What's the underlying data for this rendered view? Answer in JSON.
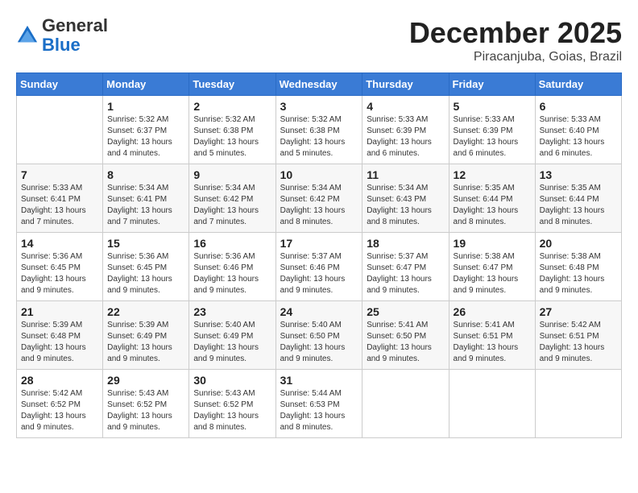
{
  "logo": {
    "general": "General",
    "blue": "Blue"
  },
  "title": "December 2025",
  "subtitle": "Piracanjuba, Goias, Brazil",
  "weekdays": [
    "Sunday",
    "Monday",
    "Tuesday",
    "Wednesday",
    "Thursday",
    "Friday",
    "Saturday"
  ],
  "weeks": [
    [
      {
        "day": "",
        "info": ""
      },
      {
        "day": "1",
        "info": "Sunrise: 5:32 AM\nSunset: 6:37 PM\nDaylight: 13 hours and 4 minutes."
      },
      {
        "day": "2",
        "info": "Sunrise: 5:32 AM\nSunset: 6:38 PM\nDaylight: 13 hours and 5 minutes."
      },
      {
        "day": "3",
        "info": "Sunrise: 5:32 AM\nSunset: 6:38 PM\nDaylight: 13 hours and 5 minutes."
      },
      {
        "day": "4",
        "info": "Sunrise: 5:33 AM\nSunset: 6:39 PM\nDaylight: 13 hours and 6 minutes."
      },
      {
        "day": "5",
        "info": "Sunrise: 5:33 AM\nSunset: 6:39 PM\nDaylight: 13 hours and 6 minutes."
      },
      {
        "day": "6",
        "info": "Sunrise: 5:33 AM\nSunset: 6:40 PM\nDaylight: 13 hours and 6 minutes."
      }
    ],
    [
      {
        "day": "7",
        "info": "Sunrise: 5:33 AM\nSunset: 6:41 PM\nDaylight: 13 hours and 7 minutes."
      },
      {
        "day": "8",
        "info": "Sunrise: 5:34 AM\nSunset: 6:41 PM\nDaylight: 13 hours and 7 minutes."
      },
      {
        "day": "9",
        "info": "Sunrise: 5:34 AM\nSunset: 6:42 PM\nDaylight: 13 hours and 7 minutes."
      },
      {
        "day": "10",
        "info": "Sunrise: 5:34 AM\nSunset: 6:42 PM\nDaylight: 13 hours and 8 minutes."
      },
      {
        "day": "11",
        "info": "Sunrise: 5:34 AM\nSunset: 6:43 PM\nDaylight: 13 hours and 8 minutes."
      },
      {
        "day": "12",
        "info": "Sunrise: 5:35 AM\nSunset: 6:44 PM\nDaylight: 13 hours and 8 minutes."
      },
      {
        "day": "13",
        "info": "Sunrise: 5:35 AM\nSunset: 6:44 PM\nDaylight: 13 hours and 8 minutes."
      }
    ],
    [
      {
        "day": "14",
        "info": "Sunrise: 5:36 AM\nSunset: 6:45 PM\nDaylight: 13 hours and 9 minutes."
      },
      {
        "day": "15",
        "info": "Sunrise: 5:36 AM\nSunset: 6:45 PM\nDaylight: 13 hours and 9 minutes."
      },
      {
        "day": "16",
        "info": "Sunrise: 5:36 AM\nSunset: 6:46 PM\nDaylight: 13 hours and 9 minutes."
      },
      {
        "day": "17",
        "info": "Sunrise: 5:37 AM\nSunset: 6:46 PM\nDaylight: 13 hours and 9 minutes."
      },
      {
        "day": "18",
        "info": "Sunrise: 5:37 AM\nSunset: 6:47 PM\nDaylight: 13 hours and 9 minutes."
      },
      {
        "day": "19",
        "info": "Sunrise: 5:38 AM\nSunset: 6:47 PM\nDaylight: 13 hours and 9 minutes."
      },
      {
        "day": "20",
        "info": "Sunrise: 5:38 AM\nSunset: 6:48 PM\nDaylight: 13 hours and 9 minutes."
      }
    ],
    [
      {
        "day": "21",
        "info": "Sunrise: 5:39 AM\nSunset: 6:48 PM\nDaylight: 13 hours and 9 minutes."
      },
      {
        "day": "22",
        "info": "Sunrise: 5:39 AM\nSunset: 6:49 PM\nDaylight: 13 hours and 9 minutes."
      },
      {
        "day": "23",
        "info": "Sunrise: 5:40 AM\nSunset: 6:49 PM\nDaylight: 13 hours and 9 minutes."
      },
      {
        "day": "24",
        "info": "Sunrise: 5:40 AM\nSunset: 6:50 PM\nDaylight: 13 hours and 9 minutes."
      },
      {
        "day": "25",
        "info": "Sunrise: 5:41 AM\nSunset: 6:50 PM\nDaylight: 13 hours and 9 minutes."
      },
      {
        "day": "26",
        "info": "Sunrise: 5:41 AM\nSunset: 6:51 PM\nDaylight: 13 hours and 9 minutes."
      },
      {
        "day": "27",
        "info": "Sunrise: 5:42 AM\nSunset: 6:51 PM\nDaylight: 13 hours and 9 minutes."
      }
    ],
    [
      {
        "day": "28",
        "info": "Sunrise: 5:42 AM\nSunset: 6:52 PM\nDaylight: 13 hours and 9 minutes."
      },
      {
        "day": "29",
        "info": "Sunrise: 5:43 AM\nSunset: 6:52 PM\nDaylight: 13 hours and 9 minutes."
      },
      {
        "day": "30",
        "info": "Sunrise: 5:43 AM\nSunset: 6:52 PM\nDaylight: 13 hours and 8 minutes."
      },
      {
        "day": "31",
        "info": "Sunrise: 5:44 AM\nSunset: 6:53 PM\nDaylight: 13 hours and 8 minutes."
      },
      {
        "day": "",
        "info": ""
      },
      {
        "day": "",
        "info": ""
      },
      {
        "day": "",
        "info": ""
      }
    ]
  ]
}
